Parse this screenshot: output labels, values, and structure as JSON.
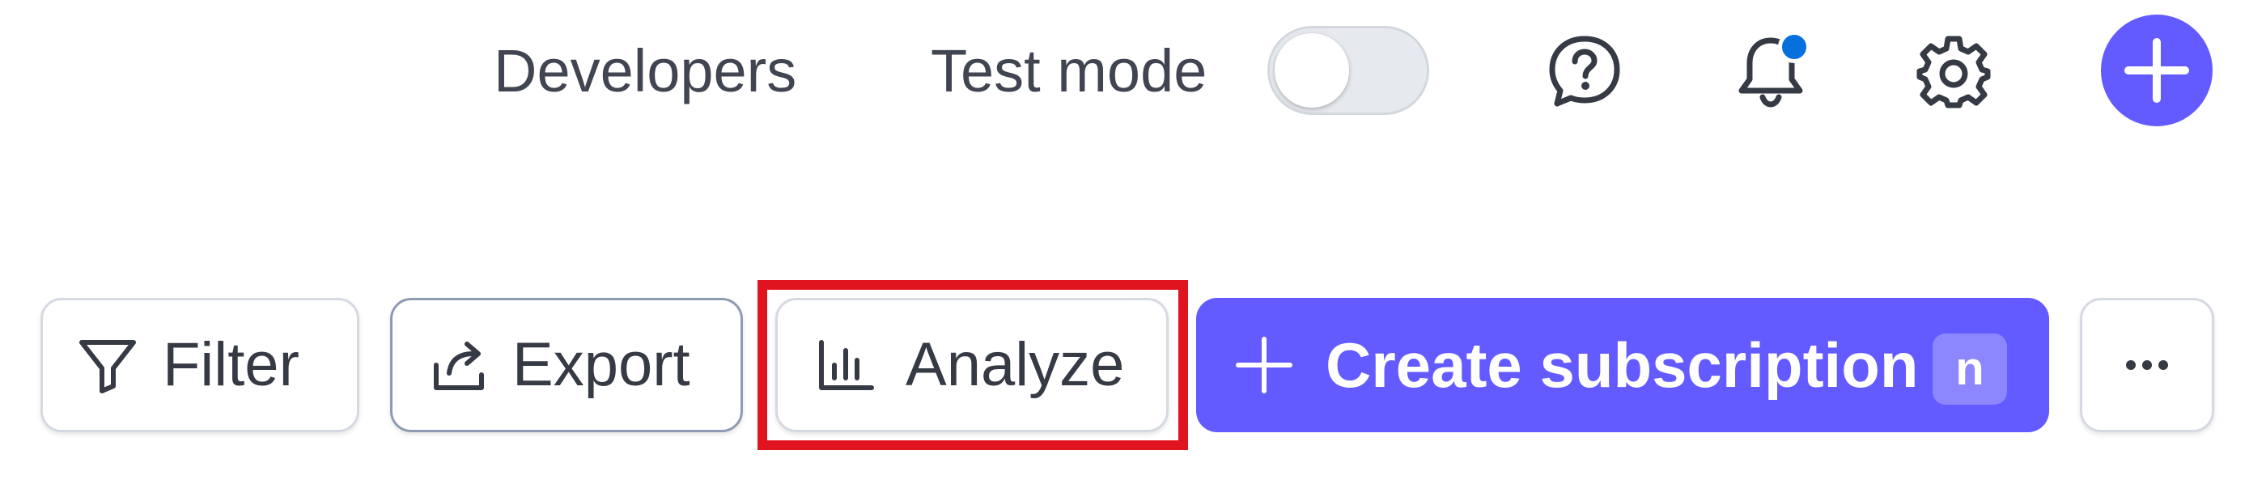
{
  "header": {
    "developers_label": "Developers",
    "test_mode_label": "Test mode",
    "test_mode_enabled": false,
    "icons": [
      "help-icon",
      "notification-bell-icon",
      "settings-gear-icon",
      "plus-icon"
    ],
    "notification_dot_color": "#0570de",
    "create_color": "#635bff"
  },
  "toolbar": {
    "filter_label": "Filter",
    "export_label": "Export",
    "analyze_label": "Analyze",
    "create_label": "Create subscription",
    "create_shortcut": "n",
    "more_icon": "more-horizontal-icon",
    "highlight_color": "#e0141e",
    "primary_color": "#635bff"
  }
}
